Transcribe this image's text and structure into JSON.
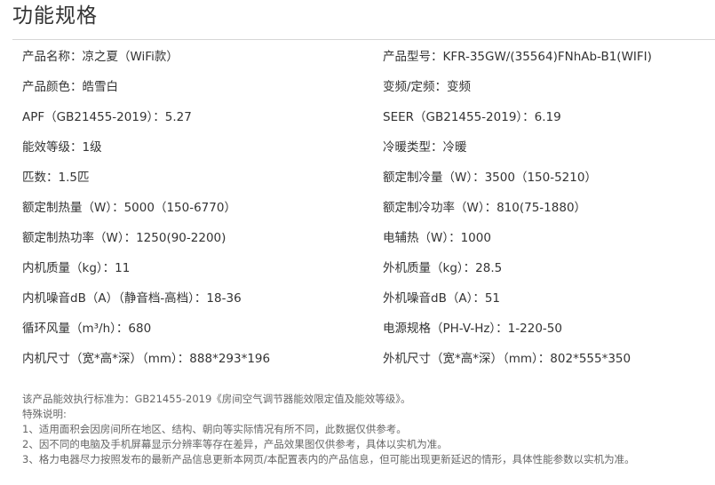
{
  "title": "功能规格",
  "specs": [
    [
      "产品名称：凉之夏（WiFi款）",
      "产品型号：KFR-35GW/(35564)FNhAb-B1(WIFI)"
    ],
    [
      "产品颜色：皓雪白",
      "变频/定频：变频"
    ],
    [
      "APF（GB21455-2019）：5.27",
      "SEER（GB21455-2019）：6.19"
    ],
    [
      "能效等级：1级",
      "冷暖类型：冷暖"
    ],
    [
      "匹数：1.5匹",
      "额定制冷量（W）：3500（150-5210）"
    ],
    [
      "额定制热量（W）：5000（150-6770）",
      "额定制冷功率（W）：810(75-1880）"
    ],
    [
      "额定制热功率（W）：1250(90-2200)",
      "电辅热（W）：1000"
    ],
    [
      "内机质量（kg）：11",
      "外机质量（kg）：28.5"
    ],
    [
      "内机噪音dB（A）（静音档-高档）：18-36",
      "外机噪音dB（A）：51"
    ],
    [
      "循环风量（m³/h）：680",
      "电源规格（PH-V-Hz）：1-220-50"
    ],
    [
      "内机尺寸（宽*高*深）（mm）：888*293*196",
      "外机尺寸（宽*高*深）（mm）：802*555*350"
    ]
  ],
  "notes": [
    "该产品能效执行标准为：GB21455-2019《房间空气调节器能效限定值及能效等级》。",
    "特殊说明:",
    "1、适用面积会因房间所在地区、结构、朝向等实际情况有所不同，此数据仅供参考。",
    "2、因不同的电脑及手机屏幕显示分辨率等存在差异，产品效果图仅供参考，具体以实机为准。",
    "3、格力电器尽力按照发布的最新产品信息更新本网页/本配置表内的产品信息，但可能出现更新延迟的情形，具体性能参数以实机为准。"
  ]
}
